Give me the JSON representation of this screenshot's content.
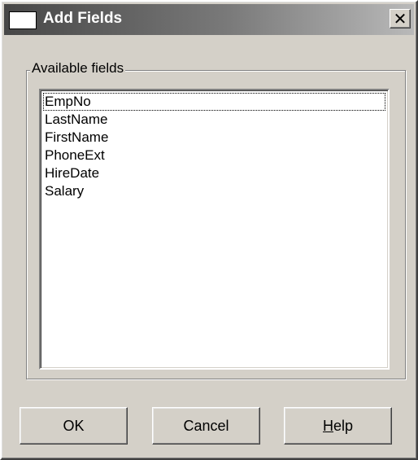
{
  "window": {
    "title": "Add Fields",
    "close_glyph": "✕"
  },
  "group": {
    "label": "Available fields"
  },
  "fields": [
    "EmpNo",
    "LastName",
    "FirstName",
    "PhoneExt",
    "HireDate",
    "Salary"
  ],
  "focused_field": "EmpNo",
  "buttons": {
    "ok": "OK",
    "cancel": "Cancel",
    "help_hotkey": "H",
    "help_rest": "elp"
  },
  "colors": {
    "face": "#d4d0c8",
    "title_start": "#474747",
    "title_end": "#b9b9b9"
  }
}
